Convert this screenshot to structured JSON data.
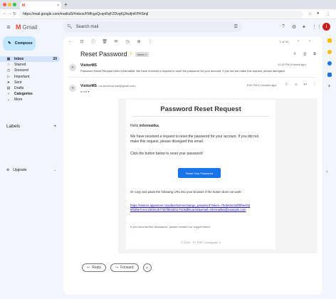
{
  "browser": {
    "tab_title": "",
    "tab_close": "×",
    "new_tab": "+",
    "url": "https://mail.google.com/mail/u/0/#inbox/FMfcgzQcqnRqFZDvqKjJhwfjnKPHSmjl"
  },
  "app": {
    "name": "Gmail",
    "logo_letter": "M",
    "avatar_letter": "I"
  },
  "search": {
    "placeholder": "Search mail"
  },
  "sidebar": {
    "compose_label": "Compose",
    "items": [
      {
        "label": "Inbox",
        "count": "20",
        "icon": "▣"
      },
      {
        "label": "Starred",
        "count": "",
        "icon": "☆"
      },
      {
        "label": "Snoozed",
        "count": "",
        "icon": "◷"
      },
      {
        "label": "Important",
        "count": "",
        "icon": "▷"
      },
      {
        "label": "Sent",
        "count": "",
        "icon": "➤"
      },
      {
        "label": "Drafts",
        "count": "",
        "icon": "▤"
      },
      {
        "label": "Categories",
        "count": "",
        "icon": "›"
      },
      {
        "label": "More",
        "count": "",
        "icon": "⌄"
      }
    ],
    "labels_heading": "Labels",
    "labels_add": "+",
    "upgrade_label": "Upgrade",
    "upgrade_arrow": "→"
  },
  "toolbar": {
    "pagination": "1 of 34"
  },
  "thread": {
    "subject": "Reset Password",
    "label_chip": "Inbox ×"
  },
  "message1": {
    "sender": "VisitorMS",
    "snippet": "Password Reset Request Hello informatika, We have received a request to reset the password for your account. If you did not make this request, please disregard",
    "time": "12:19 PM (6 hours ago)"
  },
  "message2": {
    "sender": "VisitorMS",
    "email": "<no.technical.mail@gmail.com>",
    "to": "to me ▾",
    "time": "6:53 PM (0 minutes ago)"
  },
  "email": {
    "title": "Password Reset Request",
    "greeting_prefix": "Hello ",
    "greeting_name": "informatika",
    "greeting_suffix": ",",
    "p1": "We have received a request to reset the password for your account. If you did not make this request, please disregard this email.",
    "p2": "Click the button below to reset your password:",
    "button": "Reset Your Password",
    "p3": "Or copy and paste the following URL into your browser if the button does not work:",
    "link": "https://visitors.appserver.cloudworks/msrchange_password?token=75eb62e34df5f9e4026f0d9e7cecc1902e2577dcf9b4d31176c5db5cac92&email=informatika@example.com",
    "help": "If you need further assistance, please contact our support team.",
    "footer": "© 2025 - PT PHP Codeigniter 4"
  },
  "actions": {
    "reply": "Reply",
    "forward": "Forward"
  },
  "colors": {
    "accent": "#1a73e8",
    "compose": "#c2e7ff",
    "active_nav": "#d3e3fd"
  }
}
